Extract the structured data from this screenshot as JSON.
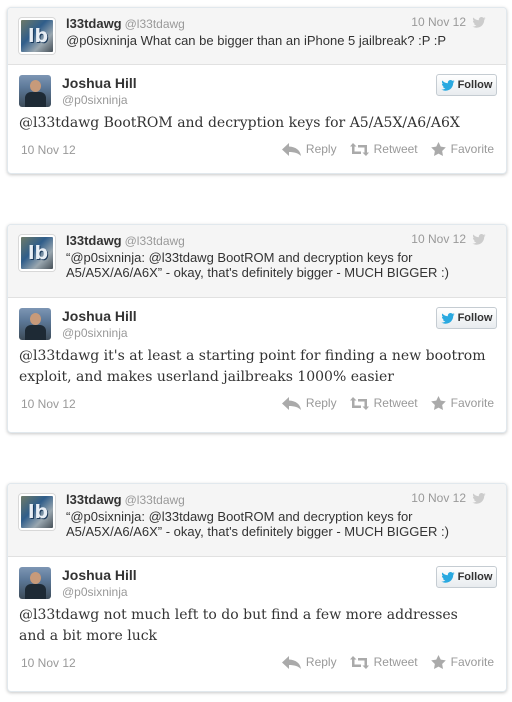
{
  "tweets": [
    {
      "parent": {
        "name": "l33tdawg",
        "handle": "@l33tdawg",
        "date": "10 Nov 12",
        "text": "@p0sixninja What can be bigger than an iPhone 5 jailbreak? :P :P"
      },
      "main": {
        "name": "Joshua Hill",
        "handle": "@p0sixninja",
        "follow_label": "Follow",
        "text": "@l33tdawg BootROM and decryption keys for A5/A5X/A6/A6X",
        "date": "10 Nov 12"
      }
    },
    {
      "parent": {
        "name": "l33tdawg",
        "handle": "@l33tdawg",
        "date": "10 Nov 12",
        "text": "“@p0sixninja: @l33tdawg BootROM and decryption keys for A5/A5X/A6/A6X” - okay, that's definitely bigger - MUCH BIGGER :)"
      },
      "main": {
        "name": "Joshua Hill",
        "handle": "@p0sixninja",
        "follow_label": "Follow",
        "text": "@l33tdawg it's at least a starting point for finding a new bootrom exploit, and makes userland jailbreaks 1000% easier",
        "date": "10 Nov 12"
      }
    },
    {
      "parent": {
        "name": "l33tdawg",
        "handle": "@l33tdawg",
        "date": "10 Nov 12",
        "text": "“@p0sixninja: @l33tdawg BootROM and decryption keys for A5/A5X/A6/A6X” - okay, that's definitely bigger - MUCH BIGGER :)"
      },
      "main": {
        "name": "Joshua Hill",
        "handle": "@p0sixninja",
        "follow_label": "Follow",
        "text": "@l33tdawg not much left to do but find a few more addresses and a bit more luck",
        "date": "10 Nov 12"
      }
    }
  ],
  "actions": {
    "reply": "Reply",
    "retweet": "Retweet",
    "favorite": "Favorite"
  },
  "icons": {
    "bird": "twitter-bird-icon",
    "reply": "reply-arrow-icon",
    "retweet": "retweet-icon",
    "favorite": "star-icon"
  },
  "colors": {
    "twitter_blue": "#2aa9e0",
    "text": "#333333",
    "muted": "#999999",
    "action_icon": "#aaaaaa"
  },
  "avatar_text": "lb"
}
